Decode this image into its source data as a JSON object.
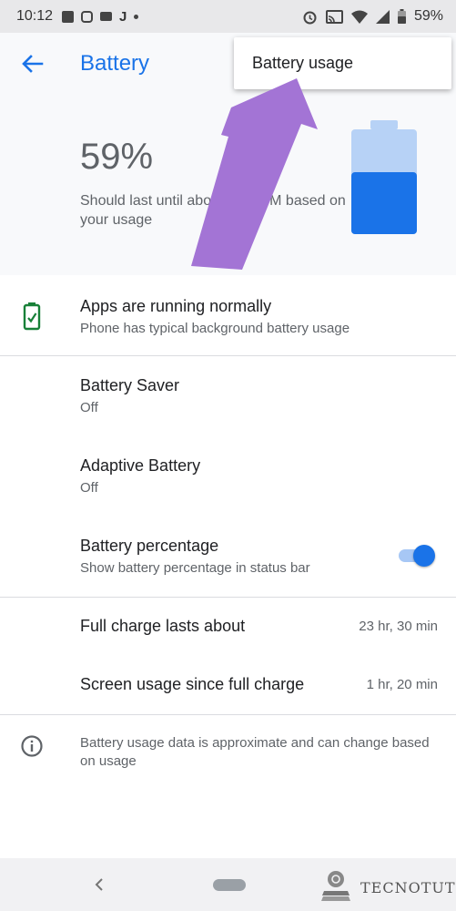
{
  "status_bar": {
    "time": "10:12",
    "notification_icons": [
      "facebook-icon",
      "instagram-icon",
      "gmail-icon",
      "j-icon",
      "dot-icon"
    ],
    "j_glyph": "J",
    "battery_text": "59%",
    "system_icons": [
      "alarm-icon",
      "cast-icon",
      "wifi-icon",
      "signal-icon",
      "battery-icon"
    ]
  },
  "app_bar": {
    "title": "Battery",
    "back_icon": "arrow-back-icon"
  },
  "menu": {
    "items": [
      {
        "label": "Battery usage"
      }
    ]
  },
  "header": {
    "percent": "59%",
    "estimate": "Should last until about 9:45 PM based on your usage",
    "battery_level": 0.59,
    "battery_color": "#1a73e8",
    "battery_empty_color": "#b7d2f6"
  },
  "annotation_arrow_color": "#a374d5",
  "status_row": {
    "title": "Apps are running normally",
    "subtitle": "Phone has typical background battery usage",
    "icon": "battery-check-icon",
    "icon_color": "#188038"
  },
  "settings": [
    {
      "title": "Battery Saver",
      "subtitle": "Off"
    },
    {
      "title": "Adaptive Battery",
      "subtitle": "Off"
    },
    {
      "title": "Battery percentage",
      "subtitle": "Show battery percentage in status bar",
      "toggle_on": true
    }
  ],
  "stats": [
    {
      "label": "Full charge lasts about",
      "value": "23 hr, 30 min"
    },
    {
      "label": "Screen usage since full charge",
      "value": "1 hr, 20 min"
    }
  ],
  "footer": {
    "text": "Battery usage data is approximate and can change based on usage",
    "icon": "info-icon"
  },
  "nav_bar": {
    "back_icon": "nav-back-icon",
    "home_icon": "home-pill-icon"
  },
  "watermark": {
    "text": "TECNOTUTO"
  },
  "colors": {
    "accent": "#1a73e8",
    "background": "#f8f9fb",
    "divider": "#dadce0"
  }
}
